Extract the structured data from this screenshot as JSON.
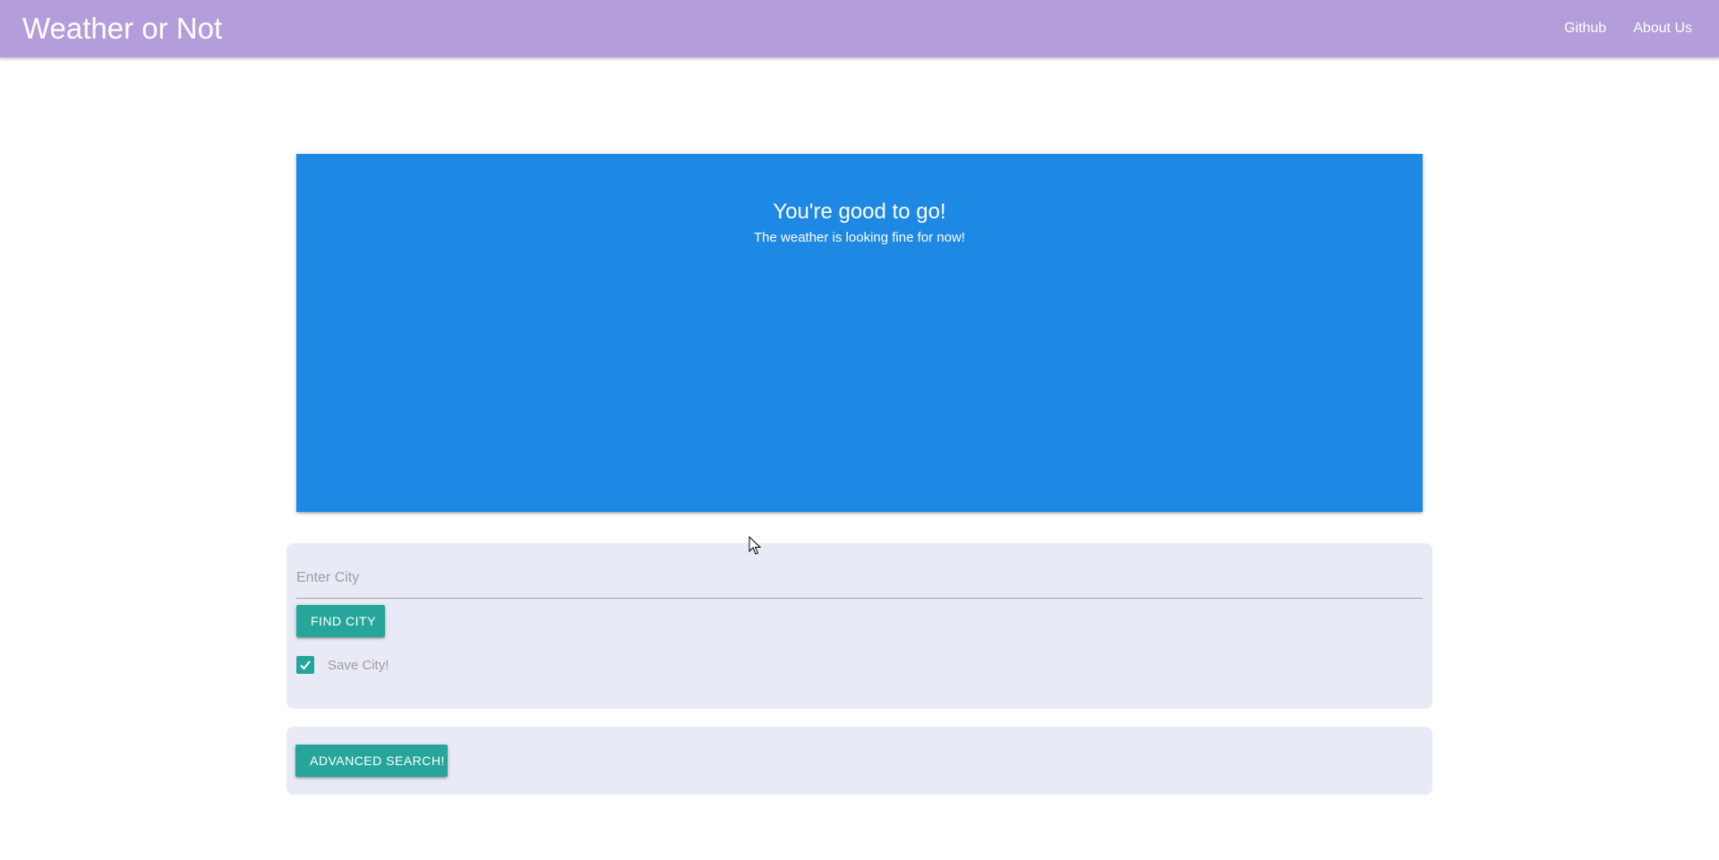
{
  "navbar": {
    "brand": "Weather or Not",
    "links": [
      {
        "label": "Github"
      },
      {
        "label": "About Us"
      }
    ]
  },
  "hero": {
    "title": "You're good to go!",
    "subtitle": "The weather is looking fine for now!"
  },
  "search": {
    "placeholder": "Enter City",
    "value": "",
    "find_button_label": "Find City",
    "save_checkbox_checked": true,
    "save_label": "Save City!"
  },
  "advanced": {
    "button_label": "Advanced Search!"
  },
  "colors": {
    "navbar": "#b39ddb",
    "hero": "#1e88e5",
    "panel": "#e8eaf6",
    "accent": "#26a69a"
  },
  "icons": {
    "checkbox": "check-icon",
    "cursor": "mouse-pointer-icon"
  }
}
